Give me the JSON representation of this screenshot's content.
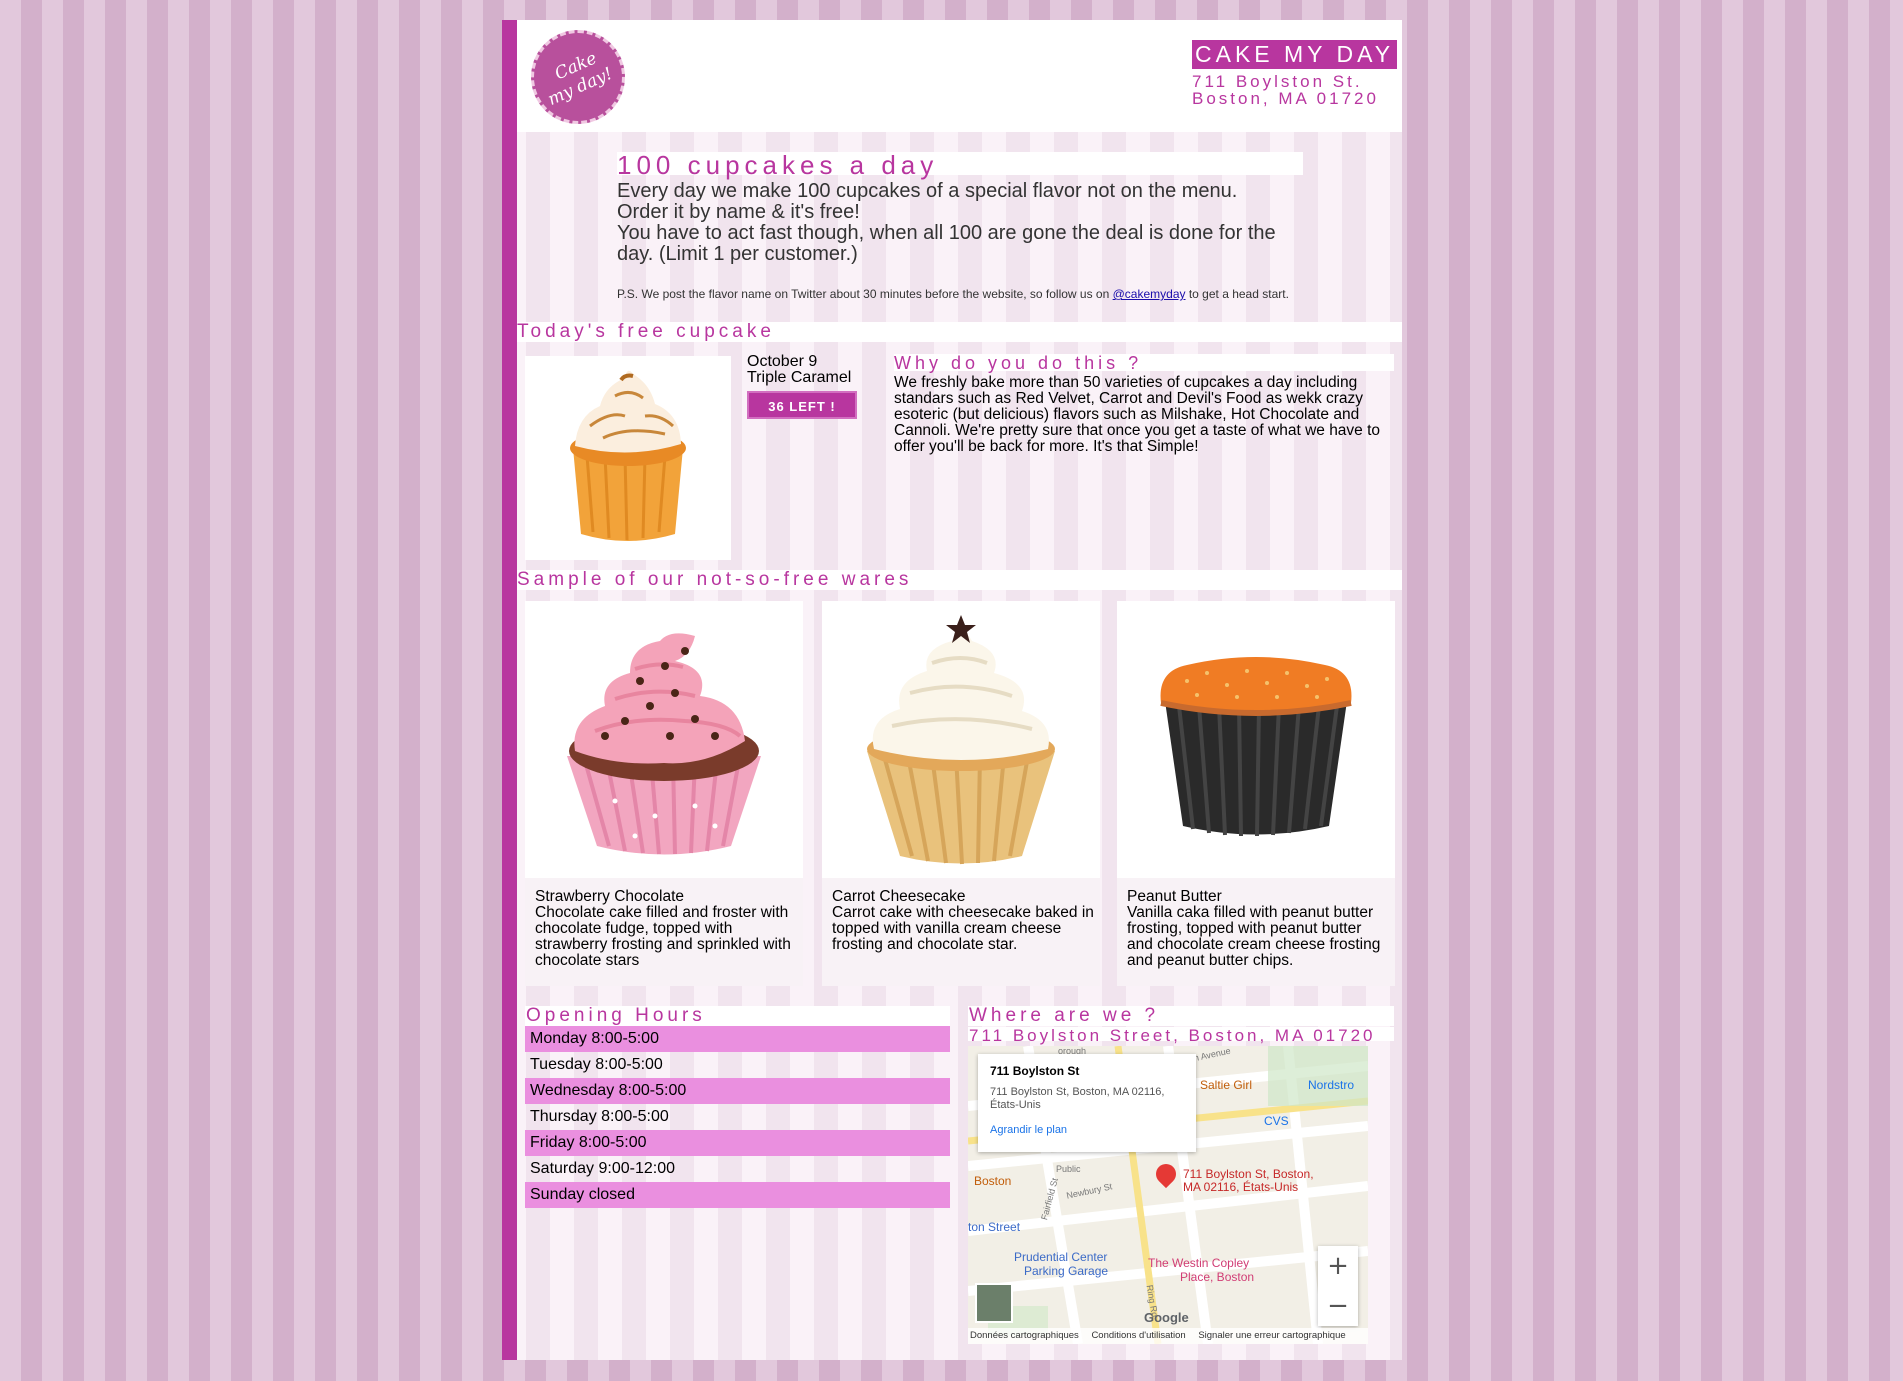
{
  "header": {
    "brand": "CAKE MY DAY",
    "address_line1": "711 Boylston St.",
    "address_line2": "Boston, MA 01720",
    "logo_text_line1": "Cake",
    "logo_text_line2": "my day!"
  },
  "promo": {
    "title": "100 cupcakes a day",
    "body_line1": "Every day we make 100 cupcakes of a special flavor not on the menu.",
    "body_line2": "Order it by name & it's free!",
    "body_line3": "You have to act fast though, when all 100 are gone the deal is done for the day. (Limit 1 per customer.)",
    "ps_prefix": "P.S. We post the flavor name on Twitter about 30 minutes before the website, so follow us on ",
    "ps_link": "@cakemyday",
    "ps_suffix": " to get a head start."
  },
  "free_cupcake": {
    "heading": "Today's free cupcake",
    "date": "October 9",
    "flavor": "Triple Caramel",
    "left_badge": "36 LEFT !",
    "image_icon": "caramel-meringue-cupcake"
  },
  "why": {
    "title": "Why do you do this ?",
    "body": "We freshly bake more than 50 varieties of cupcakes a day including standars such as Red Velvet, Carrot and Devil's Food as wekk crazy esoteric (but delicious) flavors such as Milshake, Hot Chocolate and Cannoli. We're pretty sure that once you get a taste of what we have to offer you'll be back for more. It's that Simple!"
  },
  "wares": {
    "heading": "Sample of our not-so-free wares",
    "items": [
      {
        "name": "Strawberry Chocolate",
        "desc": "Chocolate cake filled and froster with chocolate fudge, topped with strawberry frosting and sprinkled with chocolate stars",
        "frosting": "#f4a3b9",
        "wrapper": "#f2a6c0"
      },
      {
        "name": "Carrot Cheesecake",
        "desc": "Carrot cake with cheesecake baked in topped with vanilla cream cheese frosting and chocolate star.",
        "frosting": "#fbf6ea",
        "wrapper": "#e9c27c"
      },
      {
        "name": "Peanut Butter",
        "desc": "Vanilla caka filled with peanut butter frosting, topped with peanut butter and chocolate cream cheese frosting and peanut butter chips.",
        "frosting": "#f07c24",
        "wrapper": "#2a2a2a"
      }
    ]
  },
  "hours": {
    "title": "Opening Hours",
    "rows": [
      "Monday 8:00-5:00",
      "Tuesday 8:00-5:00",
      "Wednesday 8:00-5:00",
      "Thursday 8:00-5:00",
      "Friday 8:00-5:00",
      "Saturday 9:00-12:00",
      "Sunday closed"
    ]
  },
  "where": {
    "title": "Where are we ?",
    "address": "711 Boylston Street, Boston, MA 01720"
  },
  "map": {
    "card_name": "711 Boylston St",
    "card_address_line1": "711 Boylston St, Boston, MA 02116,",
    "card_address_line2": "États-Unis",
    "card_link": "Agrandir le plan",
    "pin_label_line1": "711 Boylston St, Boston,",
    "pin_label_line2": "MA 02116, États-Unis",
    "labels": [
      "Saltie Girl",
      "Nordstro",
      "CVS",
      "Boston",
      "Prudential Center",
      "Parking Garage",
      "The Westin Copley",
      "Place, Boston",
      "ton Street",
      "Newbury St",
      "Fairfield St",
      "Ring Rd",
      "rth Avenue",
      "Public",
      "orough"
    ],
    "footer": [
      "Données cartographiques",
      "Conditions d'utilisation",
      "Signaler une erreur cartographique"
    ],
    "zoom_in": "+",
    "zoom_out": "−",
    "google": "Google"
  },
  "colors": {
    "accent": "#b8369f",
    "hours_highlight": "#ea8fdf"
  }
}
